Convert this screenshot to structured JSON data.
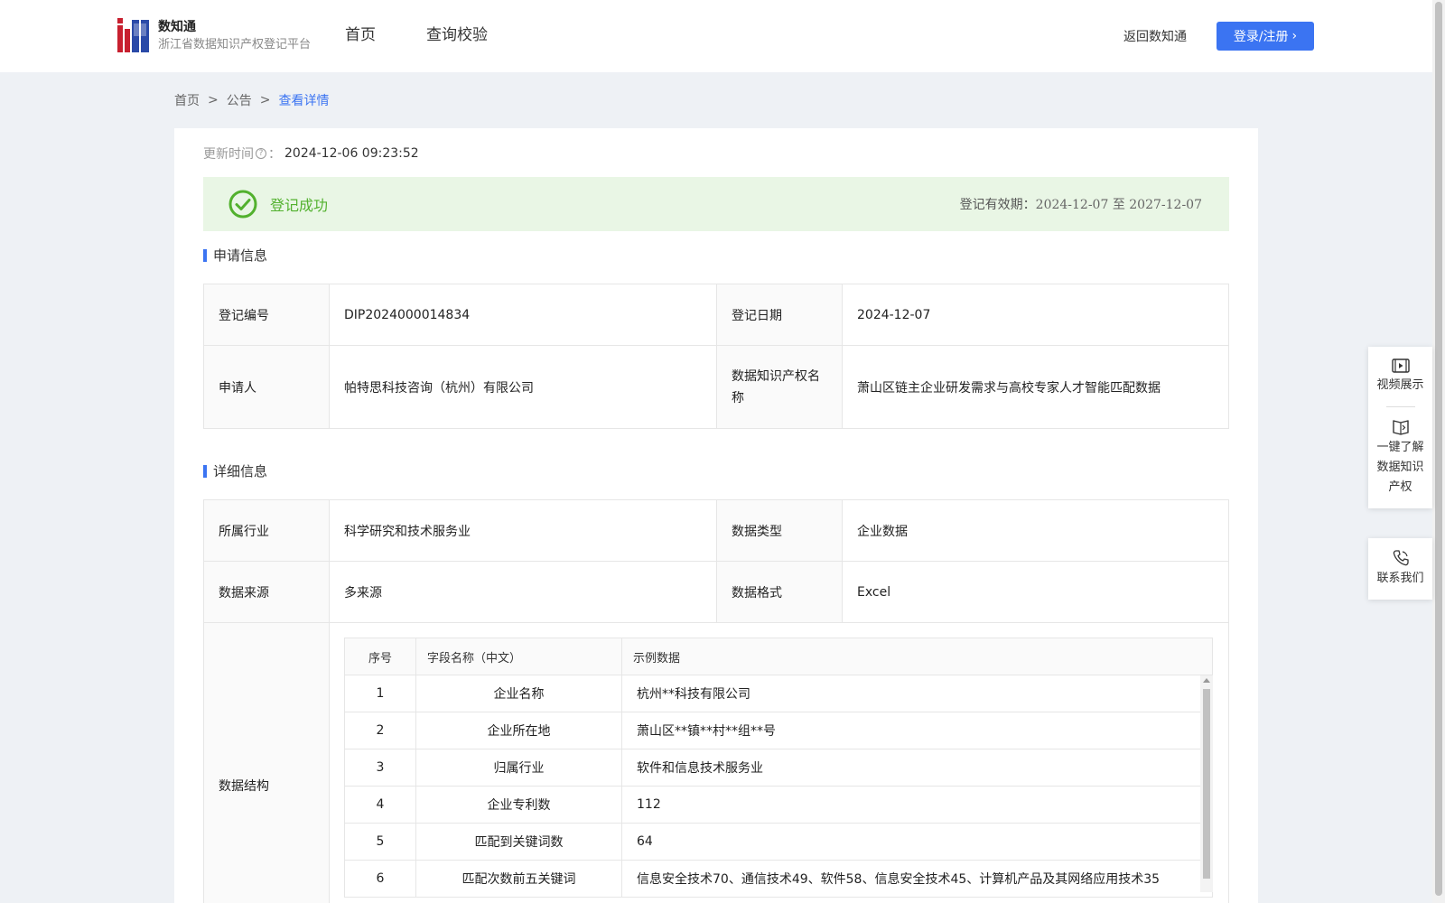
{
  "header": {
    "brand_name": "数知通",
    "brand_sub": "浙江省数据知识产权登记平台",
    "nav": [
      "首页",
      "查询校验"
    ],
    "back_link": "返回数知通",
    "login_label": "登录/注册"
  },
  "breadcrumb": {
    "items": [
      "首页",
      "公告"
    ],
    "current": "查看详情",
    "sep": ">"
  },
  "update": {
    "label": "更新时间",
    "colon": "：",
    "value": "2024-12-06 09:23:52"
  },
  "status": {
    "text": "登记成功",
    "validity_label": "登记有效期：",
    "validity_value": "2024-12-07 至 2027-12-07",
    "color": "#52b12e",
    "bg": "#e9f6e5"
  },
  "application": {
    "title": "申请信息",
    "reg_no_label": "登记编号",
    "reg_no": "DIP2024000014834",
    "reg_date_label": "登记日期",
    "reg_date": "2024-12-07",
    "applicant_label": "申请人",
    "applicant": "帕特思科技咨询（杭州）有限公司",
    "ip_name_label": "数据知识产权名称",
    "ip_name": "萧山区链主企业研发需求与高校专家人才智能匹配数据"
  },
  "detail": {
    "title": "详细信息",
    "industry_label": "所属行业",
    "industry": "科学研究和技术服务业",
    "data_type_label": "数据类型",
    "data_type": "企业数据",
    "source_label": "数据来源",
    "source": "多来源",
    "format_label": "数据格式",
    "format": "Excel",
    "structure_label": "数据结构"
  },
  "structure": {
    "columns": [
      "序号",
      "字段名称（中文）",
      "示例数据"
    ],
    "rows": [
      [
        "1",
        "企业名称",
        "杭州**科技有限公司"
      ],
      [
        "2",
        "企业所在地",
        "萧山区**镇**村**组**号"
      ],
      [
        "3",
        "归属行业",
        "软件和信息技术服务业"
      ],
      [
        "4",
        "企业专利数",
        "112"
      ],
      [
        "5",
        "匹配到关键词数",
        "64"
      ],
      [
        "6",
        "匹配次数前五关键词",
        "信息安全技术70、通信技术49、软件58、信息安全技术45、计算机产品及其网络应用技术35"
      ]
    ]
  },
  "side_panel": {
    "items": [
      {
        "label": "视频展示",
        "icon": "video-icon"
      },
      {
        "label": "一键了解数据知识产权",
        "icon": "book-icon"
      }
    ],
    "contact": {
      "label": "联系我们",
      "icon": "phone-icon"
    }
  },
  "colors": {
    "accent": "#3b74f2",
    "success": "#52b12e"
  }
}
